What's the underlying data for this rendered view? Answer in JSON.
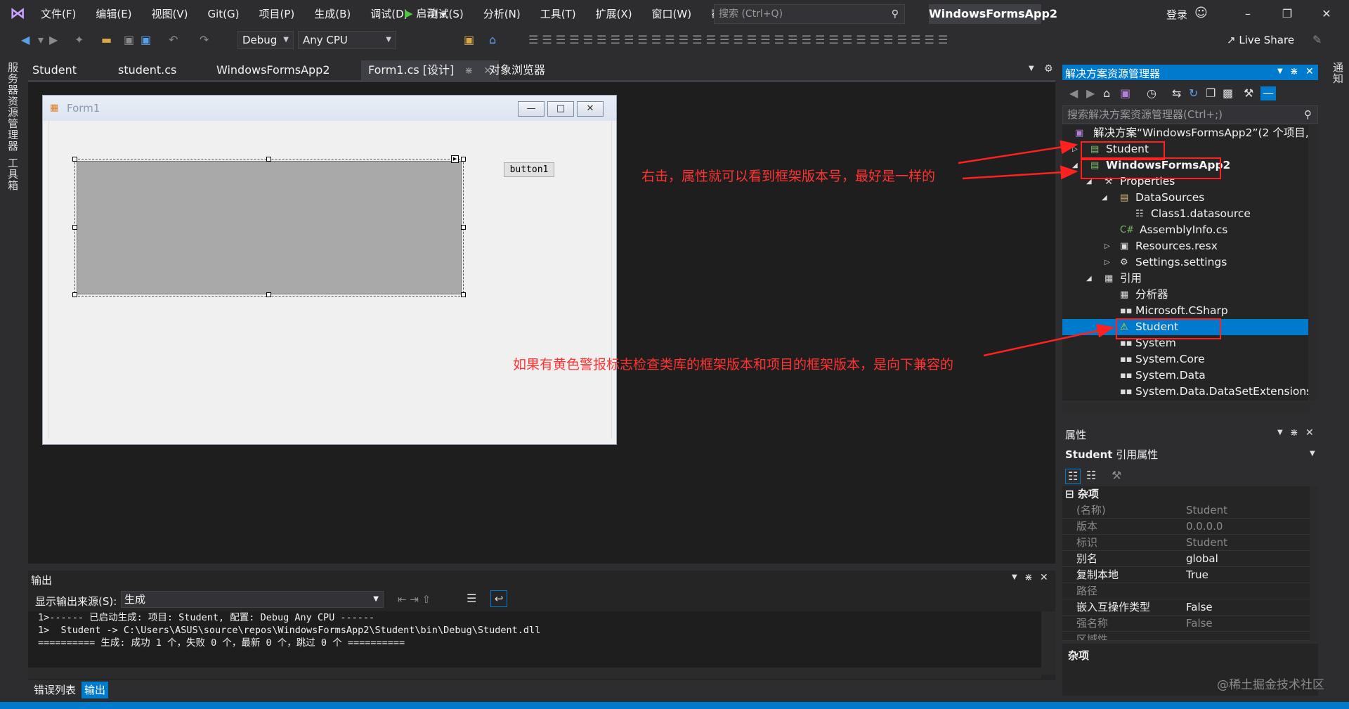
{
  "app": {
    "menus": [
      "文件(F)",
      "编辑(E)",
      "视图(V)",
      "Git(G)",
      "项目(P)",
      "生成(B)",
      "调试(D)",
      "测试(S)",
      "分析(N)",
      "工具(T)",
      "扩展(X)",
      "窗口(W)",
      "帮助(H)"
    ],
    "search_placeholder": "搜索 (Ctrl+Q)",
    "solution_name": "WindowsFormsApp2",
    "login": "登录",
    "live_share": "Live Share"
  },
  "toolbar": {
    "config": "Debug",
    "platform": "Any CPU",
    "start": "启动"
  },
  "left_strip": {
    "server_explorer": "服务器资源管理器",
    "toolbox": "工具箱"
  },
  "right_strip": {
    "notifications": "通知"
  },
  "doc_tabs": [
    {
      "label": "Student"
    },
    {
      "label": "student.cs"
    },
    {
      "label": "WindowsFormsApp2"
    },
    {
      "label": "Form1.cs [设计]"
    },
    {
      "label": "对象浏览器"
    }
  ],
  "form_designer": {
    "form_title": "Form1",
    "button_label": "button1"
  },
  "annotations": {
    "top": "右击，属性就可以看到框架版本号，最好是一样的",
    "bottom": "如果有黄色警报标志检查类库的框架版本和项目的框架版本，是向下兼容的"
  },
  "solution_explorer": {
    "title": "解决方案资源管理器",
    "search_placeholder": "搜索解决方案资源管理器(Ctrl+;)",
    "items": [
      {
        "label": "解决方案“WindowsFormsApp2”(2 个项目,",
        "icon": "solution-icon"
      },
      {
        "label": "Student",
        "icon": "csharp-project-icon"
      },
      {
        "label": "WindowsFormsApp2",
        "icon": "csharp-project-icon"
      },
      {
        "label": "Properties",
        "icon": "wrench-icon"
      },
      {
        "label": "DataSources",
        "icon": "folder-icon"
      },
      {
        "label": "Class1.datasource",
        "icon": "datasource-icon"
      },
      {
        "label": "AssemblyInfo.cs",
        "icon": "csharp-file-icon"
      },
      {
        "label": "Resources.resx",
        "icon": "resx-icon"
      },
      {
        "label": "Settings.settings",
        "icon": "settings-icon"
      },
      {
        "label": "引用",
        "icon": "references-icon"
      },
      {
        "label": "分析器",
        "icon": "analyzer-icon"
      },
      {
        "label": "Microsoft.CSharp",
        "icon": "reference-icon"
      },
      {
        "label": "Student",
        "icon": "warning-reference-icon"
      },
      {
        "label": "System",
        "icon": "reference-icon"
      },
      {
        "label": "System.Core",
        "icon": "reference-icon"
      },
      {
        "label": "System.Data",
        "icon": "reference-icon"
      },
      {
        "label": "System.Data.DataSetExtensions",
        "icon": "reference-icon"
      }
    ]
  },
  "properties": {
    "title": "属性",
    "object_name": "Student",
    "object_type": "引用属性",
    "category": "杂项",
    "rows": [
      {
        "name": "(名称)",
        "value": "Student",
        "dim": true
      },
      {
        "name": "版本",
        "value": "0.0.0.0",
        "dim": true
      },
      {
        "name": "标识",
        "value": "Student",
        "dim": true
      },
      {
        "name": "别名",
        "value": "global",
        "dim": false
      },
      {
        "name": "复制本地",
        "value": "True",
        "dim": false
      },
      {
        "name": "路径",
        "value": "",
        "dim": true
      },
      {
        "name": "嵌入互操作类型",
        "value": "False",
        "dim": false
      },
      {
        "name": "强名称",
        "value": "False",
        "dim": true
      },
      {
        "name": "区域性",
        "value": "",
        "dim": true
      }
    ],
    "description_title": "杂项"
  },
  "output": {
    "title": "输出",
    "source_label": "显示输出来源(S):",
    "source_value": "生成",
    "lines": [
      "1>------ 已启动生成: 项目: Student, 配置: Debug Any CPU ------",
      "1>  Student -> C:\\Users\\ASUS\\source\\repos\\WindowsFormsApp2\\Student\\bin\\Debug\\Student.dll",
      "========== 生成: 成功 1 个，失败 0 个，最新 0 个，跳过 0 个 =========="
    ]
  },
  "bottom_tabs": {
    "errors": "错误列表",
    "output": "输出"
  },
  "watermark": "@稀土掘金技术社区",
  "colors": {
    "accent": "#007acc",
    "annotation": "#ff3333",
    "background": "#2d2d30"
  }
}
